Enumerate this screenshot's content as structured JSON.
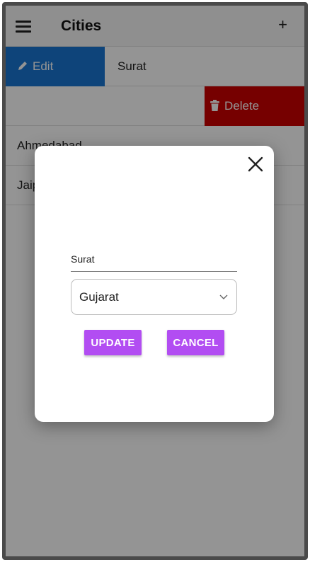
{
  "header": {
    "title": "Cities",
    "add_label": "+"
  },
  "list": {
    "row1": {
      "edit_label": "Edit",
      "city": "Surat"
    },
    "row2": {
      "delete_label": "Delete"
    },
    "row3": {
      "city": "Ahmedabad"
    },
    "row4": {
      "city": "Jaipur"
    }
  },
  "dialog": {
    "city_value": "Surat",
    "state_value": "Gujarat",
    "update_label": "UPDATE",
    "cancel_label": "CANCEL",
    "close_icon": "close-icon"
  },
  "colors": {
    "edit_action": "#1976d2",
    "delete_action": "#cc0000",
    "button": "#b24df2"
  }
}
